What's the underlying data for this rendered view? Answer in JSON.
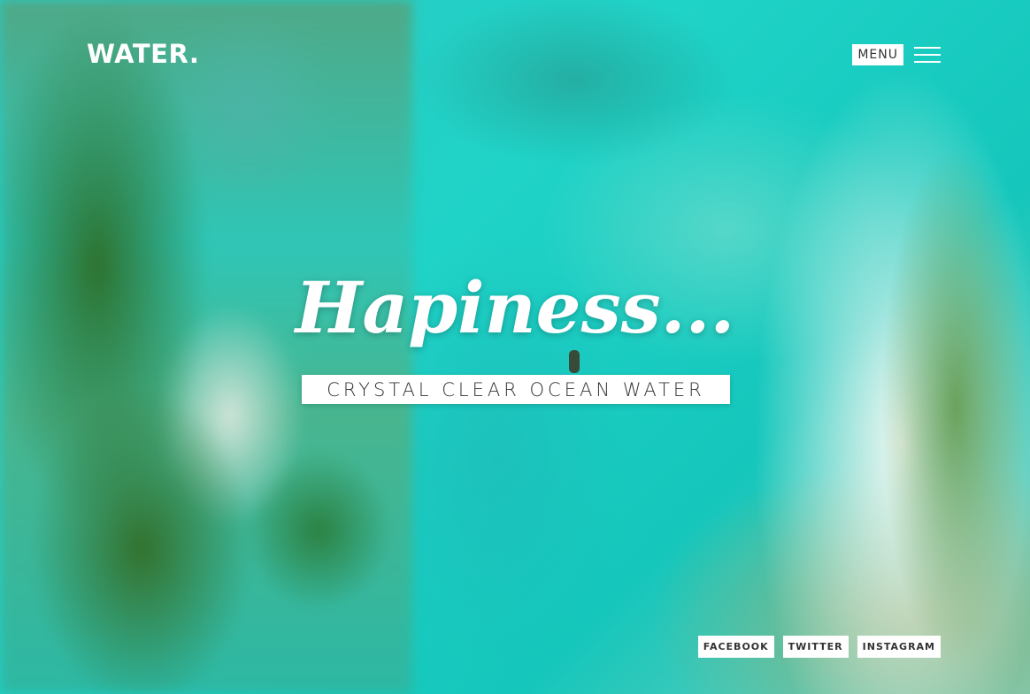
{
  "header": {
    "logo": "WATER.",
    "menu_label": "MENU"
  },
  "hero": {
    "title": "Hapiness...",
    "subtitle": "CRYSTAL CLEAR OCEAN WATER"
  },
  "social": [
    "FACEBOOK",
    "TWITTER",
    "INSTAGRAM"
  ],
  "colors": {
    "ocean": "#20d3c7",
    "text_on_light": "#333333",
    "text_on_dark": "#ffffff"
  }
}
